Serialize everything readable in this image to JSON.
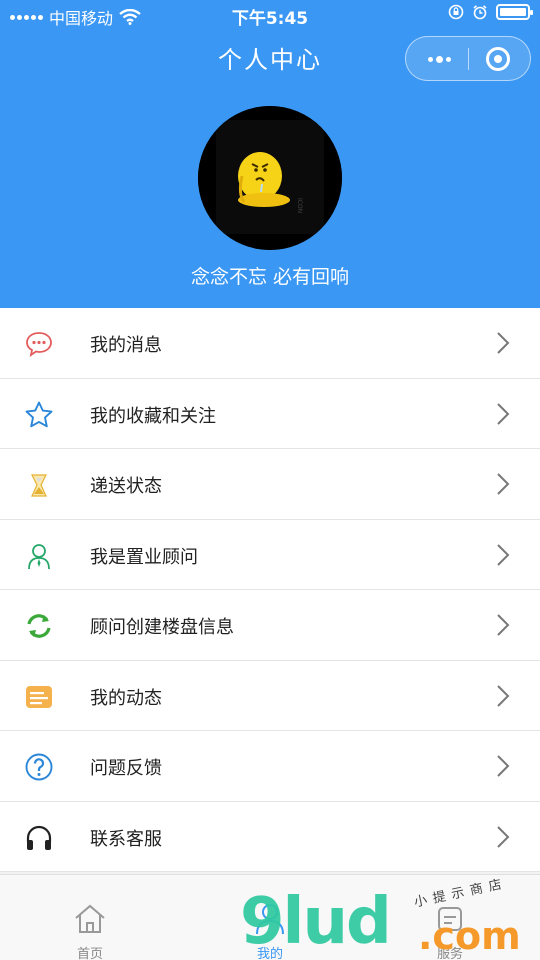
{
  "status_bar": {
    "carrier": "中国移动",
    "time": "下午5:45"
  },
  "nav": {
    "title": "个人中心"
  },
  "profile": {
    "motto": "念念不忘 必有回响"
  },
  "menu": {
    "items": [
      {
        "label": "我的消息",
        "icon": "message-icon",
        "color": "#e35b5b"
      },
      {
        "label": "我的收藏和关注",
        "icon": "star-icon",
        "color": "#2a86d8"
      },
      {
        "label": "递送状态",
        "icon": "hourglass-icon",
        "color": "#e3b232"
      },
      {
        "label": "我是置业顾问",
        "icon": "consultant-icon",
        "color": "#27a86a"
      },
      {
        "label": "顾问创建楼盘信息",
        "icon": "refresh-icon",
        "color": "#3aa93a"
      },
      {
        "label": "我的动态",
        "icon": "card-icon",
        "color": "#f5b14c"
      },
      {
        "label": "问题反馈",
        "icon": "question-icon",
        "color": "#2a86d8"
      },
      {
        "label": "联系客服",
        "icon": "headset-icon",
        "color": "#222222"
      }
    ]
  },
  "tabbar": {
    "tabs": [
      {
        "label": "首页",
        "icon": "home-icon",
        "active": false
      },
      {
        "label": "我的",
        "icon": "user-icon",
        "active": true
      },
      {
        "label": "服务",
        "icon": "service-icon",
        "active": false
      }
    ]
  },
  "watermark": {
    "main": "9lud",
    "suffix": ".com",
    "subtitle": "小提示商店"
  },
  "colors": {
    "primary": "#3a97f3",
    "background": "#f2f2f2",
    "text": "#222222",
    "divider": "#e4e4e4"
  }
}
